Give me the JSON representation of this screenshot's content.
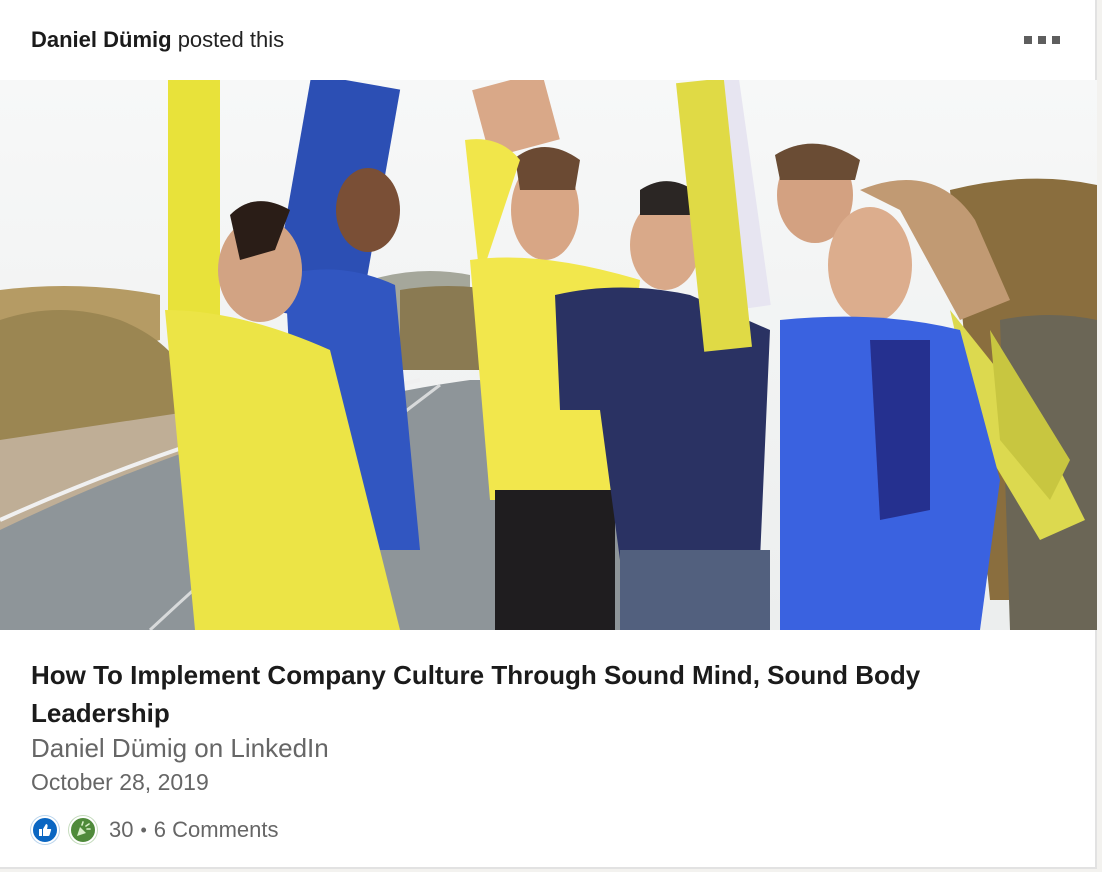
{
  "post": {
    "author_name": "Daniel Dümig",
    "action_text": " posted this",
    "more_icon": "ellipsis-icon"
  },
  "article": {
    "image_icon": "group-runners-photo",
    "title": "How To Implement Company Culture Through Sound Mind, Sound Body Leadership",
    "source": "Daniel Dümig on LinkedIn",
    "date": "October 28, 2019"
  },
  "social": {
    "reactions": [
      "like-icon",
      "celebrate-icon"
    ],
    "reaction_count": "30",
    "separator": "•",
    "comments_label": "6 Comments"
  },
  "colors": {
    "like": "#0a66c2",
    "celebrate": "#4f8a3a",
    "text_primary": "#1b1b1b",
    "text_secondary": "#666666"
  }
}
